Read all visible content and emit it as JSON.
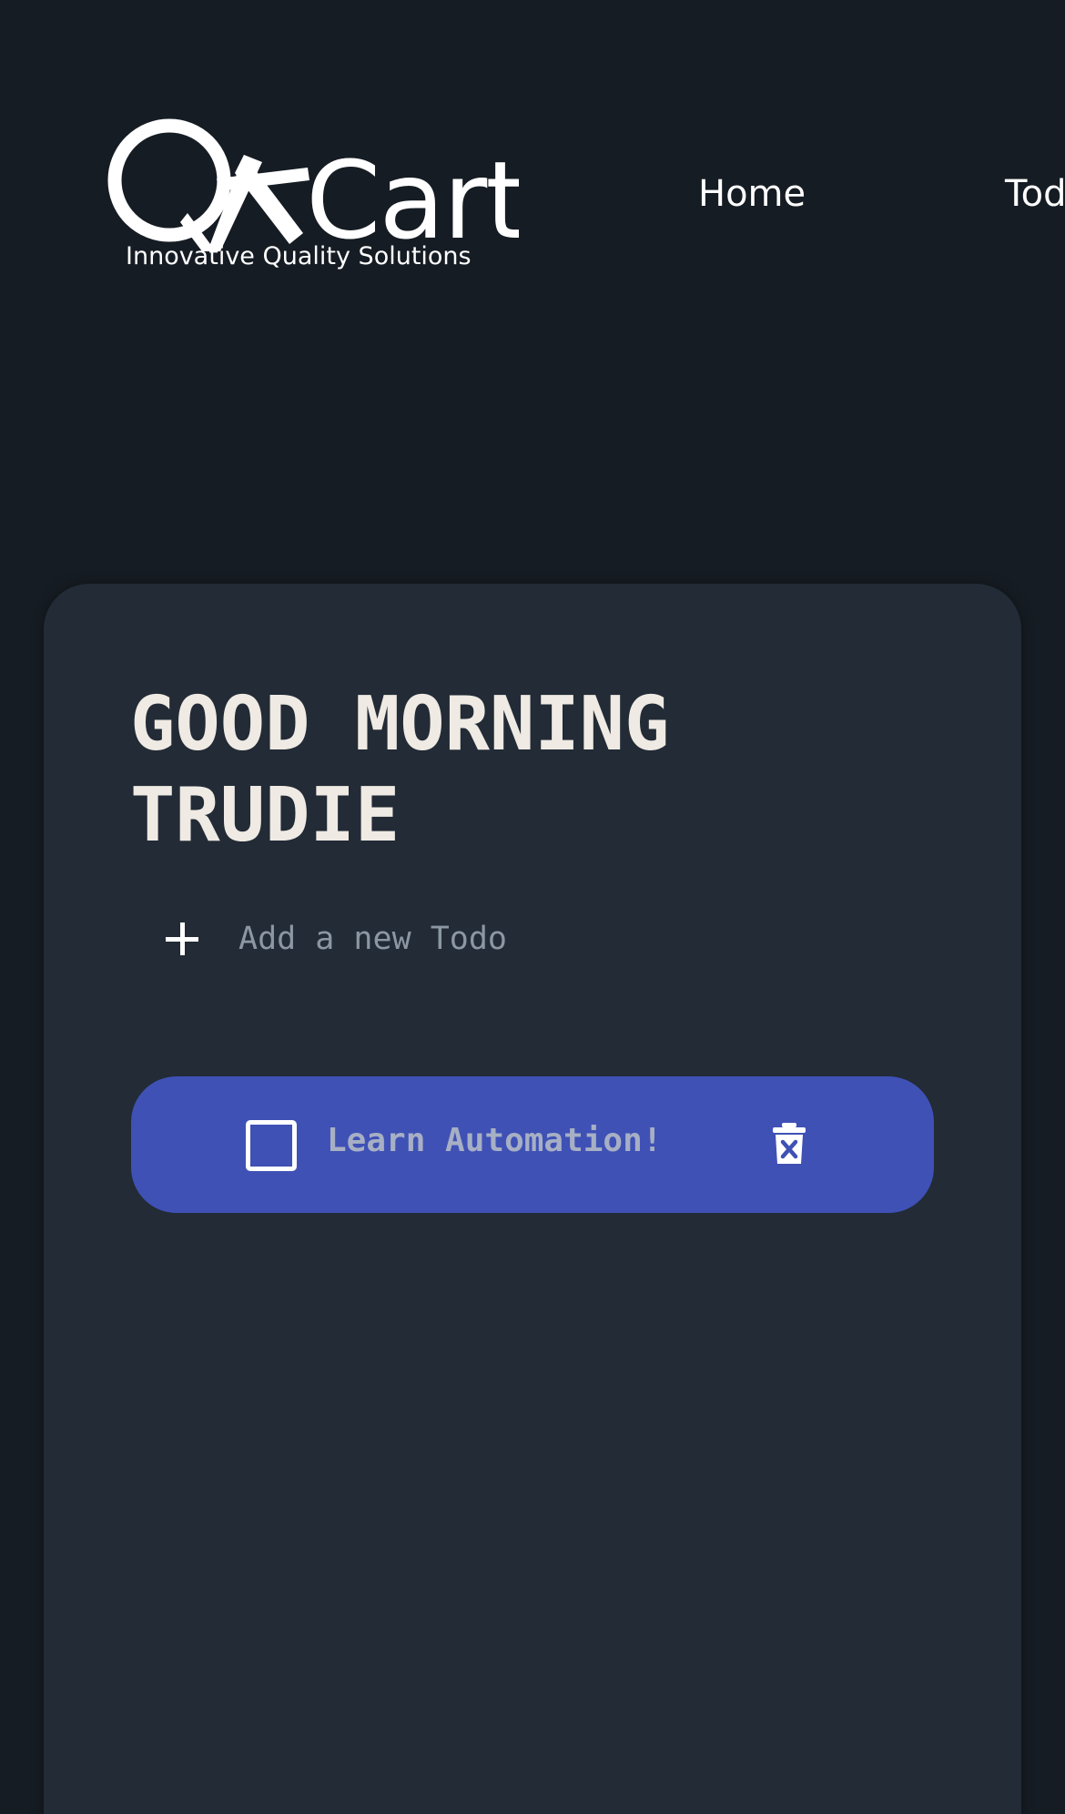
{
  "header": {
    "logo": {
      "text": "QACart",
      "tagline": "Innovative Quality Solutions"
    },
    "nav": [
      {
        "label": "Home"
      },
      {
        "label": "Todo"
      }
    ]
  },
  "main": {
    "greeting": "GOOD MORNING TRUDIE",
    "add_todo": {
      "placeholder": "Add a new Todo",
      "value": ""
    },
    "todos": [
      {
        "text": "Learn Automation!",
        "checked": false
      }
    ],
    "icons": {
      "add": "plus-icon",
      "checkbox": "checkbox-icon",
      "delete": "trash-icon"
    }
  },
  "colors": {
    "background": "#161c23",
    "card": "#222b36",
    "todo_item": "#3f51b5",
    "greeting_text": "#efeae3",
    "muted_text": "#8c97a3",
    "white": "#ffffff"
  }
}
